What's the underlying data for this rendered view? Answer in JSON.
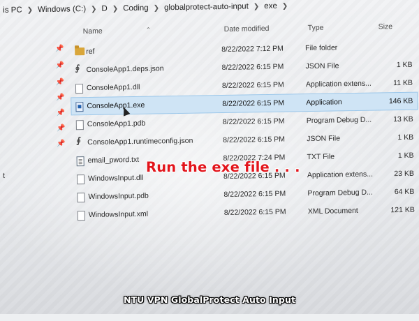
{
  "address_bar": {
    "crumbs": [
      "is PC",
      "Windows (C:)",
      "D",
      "Coding",
      "globalprotect-auto-input",
      "exe"
    ]
  },
  "columns": {
    "name": "Name",
    "date": "Date modified",
    "type": "Type",
    "size": "Size"
  },
  "files": [
    {
      "name": "ref",
      "date": "8/22/2022 7:12 PM",
      "type": "File folder",
      "size": "",
      "icon": "folder-icon"
    },
    {
      "name": "ConsoleApp1.deps.json",
      "date": "8/22/2022 6:15 PM",
      "type": "JSON File",
      "size": "1 KB",
      "icon": "json-file-icon"
    },
    {
      "name": "ConsoleApp1.dll",
      "date": "8/22/2022 6:15 PM",
      "type": "Application extens...",
      "size": "11 KB",
      "icon": "dll-file-icon"
    },
    {
      "name": "ConsoleApp1.exe",
      "date": "8/22/2022 6:15 PM",
      "type": "Application",
      "size": "146 KB",
      "icon": "exe-file-icon",
      "selected": true
    },
    {
      "name": "ConsoleApp1.pdb",
      "date": "8/22/2022 6:15 PM",
      "type": "Program Debug D...",
      "size": "13 KB",
      "icon": "pdb-file-icon"
    },
    {
      "name": "ConsoleApp1.runtimeconfig.json",
      "date": "8/22/2022 6:15 PM",
      "type": "JSON File",
      "size": "1 KB",
      "icon": "json-file-icon"
    },
    {
      "name": "email_pword.txt",
      "date": "8/22/2022 7:24 PM",
      "type": "TXT File",
      "size": "1 KB",
      "icon": "txt-file-icon"
    },
    {
      "name": "WindowsInput.dll",
      "date": "8/22/2022 6:15 PM",
      "type": "Application extens...",
      "size": "23 KB",
      "icon": "dll-file-icon"
    },
    {
      "name": "WindowsInput.pdb",
      "date": "8/22/2022 6:15 PM",
      "type": "Program Debug D...",
      "size": "64 KB",
      "icon": "pdb-file-icon"
    },
    {
      "name": "WindowsInput.xml",
      "date": "8/22/2022 6:15 PM",
      "type": "XML Document",
      "size": "121 KB",
      "icon": "xml-file-icon"
    }
  ],
  "left_edge_text": "t",
  "overlay": {
    "instruction": "Run the exe file . . .",
    "footer": "NTU VPN GlobalProtect Auto Input"
  },
  "colors": {
    "selection_bg": "#cfe4f5",
    "caption_red": "#e2141b",
    "folder": "#d9a63a"
  }
}
